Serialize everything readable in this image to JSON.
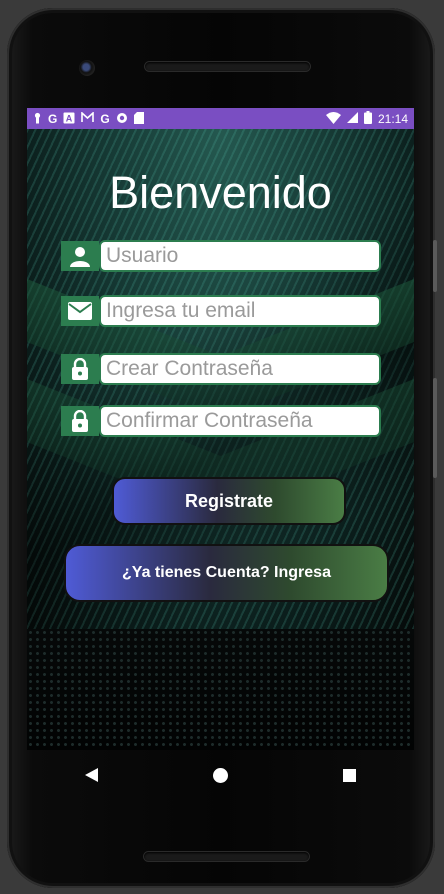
{
  "status_bar": {
    "time": "21:14",
    "left_icons": [
      "lock-icon",
      "google-icon",
      "text-icon",
      "gmail-icon",
      "google-icon",
      "circle-icon",
      "sd-card-icon"
    ],
    "right_icons": [
      "wifi-icon",
      "signal-icon",
      "battery-icon"
    ]
  },
  "screen": {
    "title": "Bienvenido",
    "fields": {
      "username": {
        "placeholder": "Usuario",
        "value": ""
      },
      "email": {
        "placeholder": "Ingresa tu email",
        "value": ""
      },
      "password": {
        "placeholder": "Crear Contraseña",
        "value": ""
      },
      "confirm_password": {
        "placeholder": "Confirmar Contraseña",
        "value": ""
      }
    },
    "register_button": "Registrate",
    "login_button": "¿Ya tienes Cuenta? Ingresa"
  },
  "colors": {
    "status_bar": "#7a4ec2",
    "field_accent": "#2c7d4f",
    "button_gradient_start": "#4f5bd6",
    "button_gradient_end": "#4a7d45"
  }
}
